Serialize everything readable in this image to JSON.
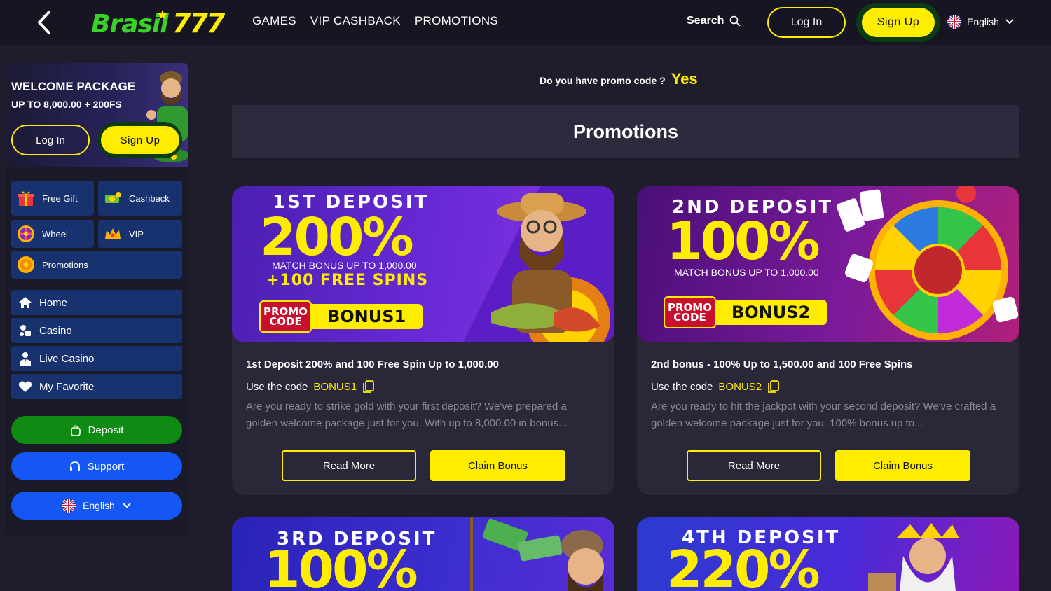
{
  "header": {
    "brand": "Brasil777",
    "nav": [
      "GAMES",
      "VIP CASHBACK",
      "PROMOTIONS"
    ],
    "search_label": "Search",
    "login_label": "Log In",
    "signup_label": "Sign Up",
    "language": "English"
  },
  "sidebar": {
    "welcome_title": "WELCOME PACKAGE",
    "welcome_sub": "UP TO 8,000.00 + 200FS",
    "login_label": "Log In",
    "signup_label": "Sign Up",
    "quick": [
      {
        "label": "Free Gift",
        "icon": "gift-icon"
      },
      {
        "label": "Cashback",
        "icon": "cashback-icon"
      },
      {
        "label": "Wheel",
        "icon": "wheel-icon"
      },
      {
        "label": "VIP",
        "icon": "crown-icon"
      },
      {
        "label": "Promotions",
        "icon": "promotions-icon"
      }
    ],
    "menu": [
      {
        "label": "Home",
        "icon": "home-icon"
      },
      {
        "label": "Casino",
        "icon": "casino-icon"
      },
      {
        "label": "Live Casino",
        "icon": "dealer-icon"
      },
      {
        "label": "My Favorite",
        "icon": "heart-icon"
      }
    ],
    "deposit_label": "Deposit",
    "support_label": "Support",
    "language": "English"
  },
  "main": {
    "promo_question": "Do you have promo code ?",
    "promo_yes": "Yes",
    "heading": "Promotions",
    "cards": [
      {
        "banner_title": "1ST DEPOSIT",
        "banner_pct": "200%",
        "banner_match": "MATCH BONUS UP TO",
        "banner_amount": "1,000.00",
        "banner_spins": "+100 FREE SPINS",
        "promo_word1": "PROMO",
        "promo_word2": "CODE",
        "banner_code": "BONUS1",
        "title": "1st Deposit 200% and 100 Free Spin Up to 1,000.00",
        "use_code_label": "Use the code",
        "code": "BONUS1",
        "description": "Are you ready to strike gold with your first deposit? We've prepared a golden welcome package just for you. With up to 8,000.00 in bonus...",
        "read_more": "Read More",
        "claim": "Claim Bonus"
      },
      {
        "banner_title": "2ND DEPOSIT",
        "banner_pct": "100%",
        "banner_match": "MATCH BONUS UP TO",
        "banner_amount": "1,000.00",
        "promo_word1": "PROMO",
        "promo_word2": "CODE",
        "banner_code": "BONUS2",
        "title": "2nd bonus - 100% Up to 1,500.00 and 100 Free Spins",
        "use_code_label": "Use the code",
        "code": "BONUS2",
        "description": "Are you ready to hit the jackpot with your second deposit? We've crafted a golden welcome package just for you. 100% bonus up to...",
        "read_more": "Read More",
        "claim": "Claim Bonus"
      },
      {
        "banner_title": "3RD DEPOSIT",
        "banner_pct": "100%"
      },
      {
        "banner_title": "4TH DEPOSIT",
        "banner_pct": "220%"
      }
    ]
  },
  "colors": {
    "accent": "#ffed00",
    "brand_green": "#39d12a",
    "menu_blue": "#17326e",
    "deposit_green": "#0f8a13",
    "support_blue": "#1457f5",
    "background": "#1f1d2b"
  }
}
